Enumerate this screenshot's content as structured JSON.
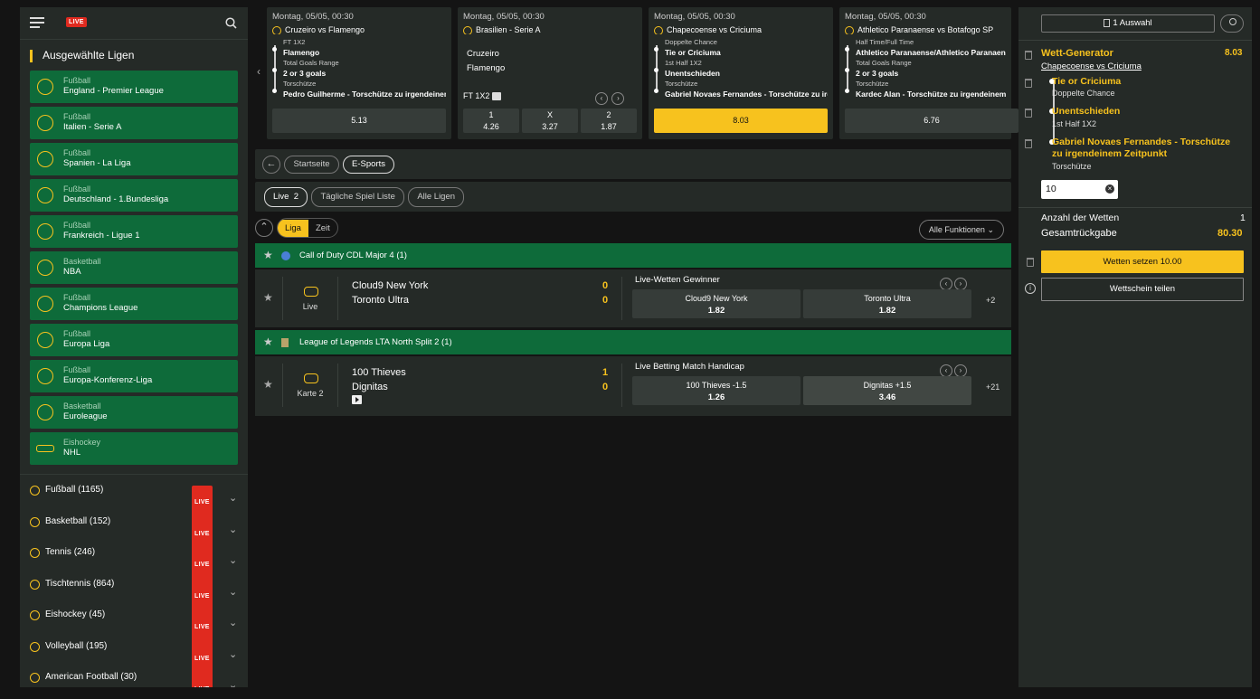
{
  "sidebar": {
    "live_label": "LIVE",
    "section_title": "Ausgewählte Ligen",
    "leagues": [
      {
        "sport": "Fußball",
        "name": "England - Premier League",
        "icon": "football-icon"
      },
      {
        "sport": "Fußball",
        "name": "Italien - Serie A",
        "icon": "football-icon"
      },
      {
        "sport": "Fußball",
        "name": "Spanien - La Liga",
        "icon": "football-icon"
      },
      {
        "sport": "Fußball",
        "name": "Deutschland - 1.Bundesliga",
        "icon": "football-icon"
      },
      {
        "sport": "Fußball",
        "name": "Frankreich - Ligue 1",
        "icon": "football-icon"
      },
      {
        "sport": "Basketball",
        "name": "NBA",
        "icon": "basketball-icon"
      },
      {
        "sport": "Fußball",
        "name": "Champions League",
        "icon": "football-icon"
      },
      {
        "sport": "Fußball",
        "name": "Europa Liga",
        "icon": "football-icon"
      },
      {
        "sport": "Fußball",
        "name": "Europa-Konferenz-Liga",
        "icon": "football-icon"
      },
      {
        "sport": "Basketball",
        "name": "Euroleague",
        "icon": "basketball-icon"
      },
      {
        "sport": "Eishockey",
        "name": "NHL",
        "icon": "hockey-icon"
      }
    ],
    "sports": [
      {
        "label": "Fußball",
        "count": "(1165)"
      },
      {
        "label": "Basketball",
        "count": "(152)"
      },
      {
        "label": "Tennis",
        "count": "(246)"
      },
      {
        "label": "Tischtennis",
        "count": "(864)"
      },
      {
        "label": "Eishockey",
        "count": "(45)"
      },
      {
        "label": "Volleyball",
        "count": "(195)"
      },
      {
        "label": "American Football",
        "count": "(30)"
      }
    ]
  },
  "carousel": [
    {
      "date": "Montag, 05/05, 00:30",
      "match": "Cruzeiro vs Flamengo",
      "legs": [
        {
          "market": "FT 1X2",
          "selection": "Flamengo"
        },
        {
          "market": "Total Goals Range",
          "selection": "2 or 3 goals"
        },
        {
          "market": "Torschütze",
          "selection": "Pedro Guilherme - Torschütze zu irgendeinem Zeitpunkt"
        }
      ],
      "odds": "5.13"
    },
    {
      "date": "Montag, 05/05, 00:30",
      "match": "Brasilien - Serie A",
      "team1": "Cruzeiro",
      "team2": "Flamengo",
      "market": "FT 1X2",
      "outcomes": [
        {
          "label": "1",
          "odds": "4.26"
        },
        {
          "label": "X",
          "odds": "3.27"
        },
        {
          "label": "2",
          "odds": "1.87"
        }
      ]
    },
    {
      "date": "Montag, 05/05, 00:30",
      "match": "Chapecoense vs Criciuma",
      "legs": [
        {
          "market": "Doppelte Chance",
          "selection": "Tie or Criciuma"
        },
        {
          "market": "1st Half 1X2",
          "selection": "Unentschieden"
        },
        {
          "market": "Torschütze",
          "selection": "Gabriel Novaes Fernandes - Torschütze zu irgendeinem Zeitpunkt"
        }
      ],
      "odds": "8.03"
    },
    {
      "date": "Montag, 05/05, 00:30",
      "match": "Athletico Paranaense vs Botafogo SP",
      "legs": [
        {
          "market": "Half Time/Full Time",
          "selection": "Athletico Paranaense/Athletico Paranaense"
        },
        {
          "market": "Total Goals Range",
          "selection": "2 or 3 goals"
        },
        {
          "market": "Torschütze",
          "selection": "Kardec Alan - Torschütze zu irgendeinem Zeitpunkt"
        }
      ],
      "odds": "6.76"
    }
  ],
  "breadcrumb": {
    "home": "Startseite",
    "current": "E-Sports"
  },
  "filters": {
    "live": "Live",
    "live_count": "2",
    "daily": "Tägliche Spiel Liste",
    "all": "Alle Ligen"
  },
  "sort": {
    "league": "Liga",
    "time": "Zeit",
    "functions": "Alle Funktionen"
  },
  "competitions": [
    {
      "name": "Call of Duty CDL Major 4 (1)",
      "event": {
        "status": "Live",
        "team1": "Cloud9 New York",
        "team2": "Toronto Ultra",
        "score1": "0",
        "score2": "0",
        "market": "Live-Wetten Gewinner",
        "odds": [
          {
            "label": "Cloud9 New York",
            "value": "1.82"
          },
          {
            "label": "Toronto Ultra",
            "value": "1.82"
          }
        ],
        "more": "+2"
      }
    },
    {
      "name": "League of Legends LTA North Split 2 (1)",
      "event": {
        "status": "Karte 2",
        "team1": "100 Thieves",
        "team2": "Dignitas",
        "score1": "1",
        "score2": "0",
        "market": "Live Betting Match Handicap",
        "odds": [
          {
            "label": "100 Thieves -1.5",
            "value": "1.26"
          },
          {
            "label": "Dignitas +1.5",
            "value": "3.46"
          }
        ],
        "more": "+21"
      }
    }
  ],
  "betslip": {
    "header": "1 Auswahl",
    "title": "Wett-Generator",
    "total_odds": "8.03",
    "match": "Chapecoense vs Criciuma",
    "legs": [
      {
        "selection": "Tie or Criciuma",
        "market": "Doppelte Chance"
      },
      {
        "selection": "Unentschieden",
        "market": "1st Half 1X2"
      },
      {
        "selection": "Gabriel Novaes Fernandes - Torschütze zu irgendeinem Zeitpunkt",
        "market": "Torschütze"
      }
    ],
    "stake": "10",
    "count_label": "Anzahl der Wetten",
    "count": "1",
    "return_label": "Gesamtrückgabe",
    "return_value": "80.30",
    "place_button": "Wetten setzen 10.00",
    "share_button": "Wettschein teilen"
  },
  "colors": {
    "accent": "#f7c21e",
    "green": "#0e6b3a",
    "panel": "#252a27",
    "live": "#e02a1f"
  }
}
